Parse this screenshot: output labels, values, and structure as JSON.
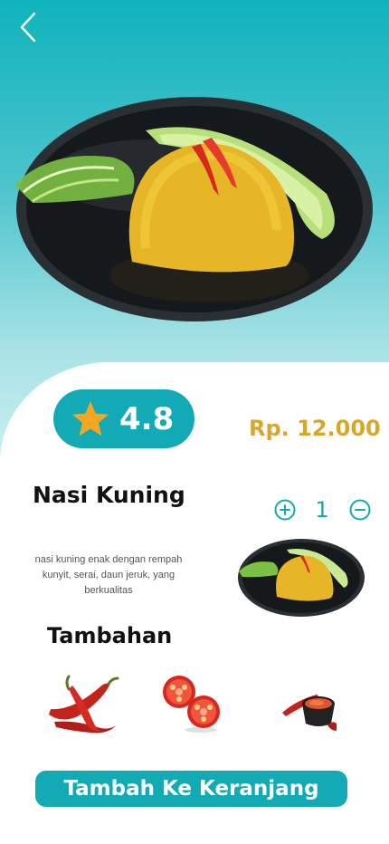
{
  "header": {
    "back_icon": "chevron-left-icon"
  },
  "product": {
    "rating": "4.8",
    "rating_icon": "star-icon",
    "price": "Rp. 12.000",
    "name": "Nasi Kuning",
    "description": "nasi kuning enak dengan rempah  kunyit, serai, daun jeruk, yang berkualitas",
    "quantity": "1",
    "quantity_controls": {
      "left_icon": "plus-circle-icon",
      "right_icon": "minus-circle-icon"
    }
  },
  "addons": {
    "title": "Tambahan",
    "items": [
      {
        "icon": "red-chili-icon"
      },
      {
        "icon": "tomato-slices-icon"
      },
      {
        "icon": "sambal-cup-icon"
      }
    ]
  },
  "cart_button": {
    "label": "Tambah Ke Keranjang"
  },
  "colors": {
    "primary": "#12aab5",
    "price": "#d9a62a",
    "header_gradient_top": "#0fb3bd",
    "header_gradient_bottom": "#cdeff1",
    "star": "#f5a623"
  }
}
